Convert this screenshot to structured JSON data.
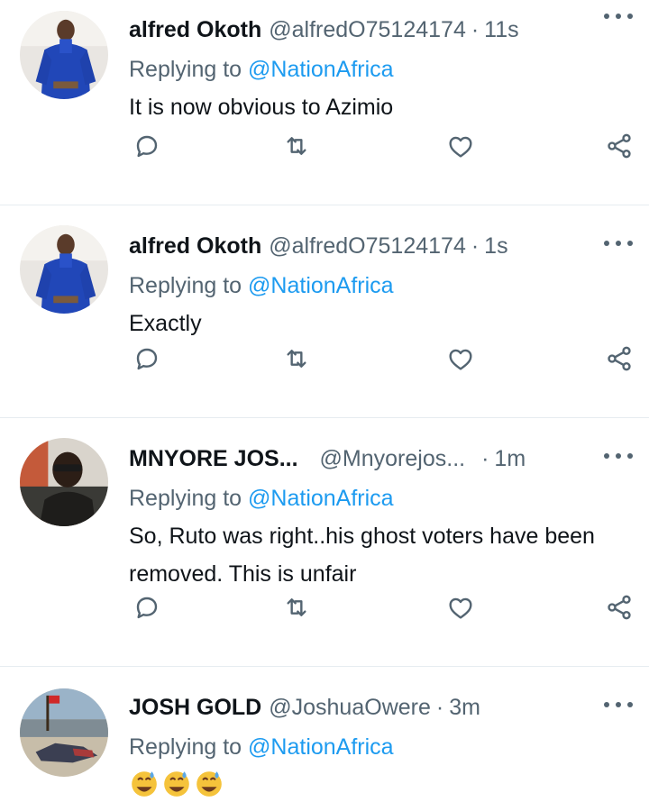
{
  "tweets": [
    {
      "name": "alfred Okoth",
      "handle": "@alfredO75124174",
      "dot": "·",
      "time": "11s",
      "reply_prefix": "Replying to",
      "reply_to": "@NationAfrica",
      "text": "It is now obvious to Azimio"
    },
    {
      "name": "alfred Okoth",
      "handle": "@alfredO75124174",
      "dot": "·",
      "time": "1s",
      "reply_prefix": "Replying to",
      "reply_to": "@NationAfrica",
      "text": "Exactly"
    },
    {
      "name": "MNYORE JOS...",
      "handle": "@Mnyorejos...",
      "dot": "·",
      "time": "1m",
      "reply_prefix": "Replying to",
      "reply_to": "@NationAfrica",
      "text": "So, Ruto was right..his ghost voters have been removed. This is unfair"
    },
    {
      "name": "JOSH GOLD",
      "handle": "@JoshuaOwere",
      "dot": "·",
      "time": "3m",
      "reply_prefix": "Replying to",
      "reply_to": "@NationAfrica",
      "emojis": [
        "😅",
        "😅",
        "😅"
      ]
    }
  ],
  "icons": [
    "reply-icon",
    "retweet-icon",
    "like-icon",
    "share-icon",
    "more-icon"
  ],
  "colors": {
    "text": "#0f1419",
    "secondary": "#536471",
    "accent": "#1d9bf0",
    "divider": "#e6ecf0"
  }
}
